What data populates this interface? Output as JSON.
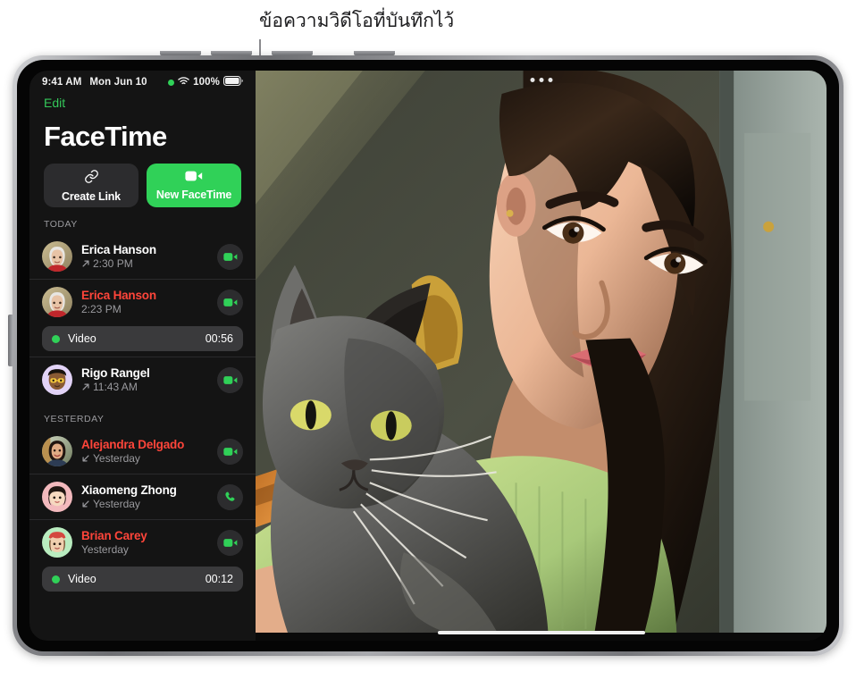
{
  "callout": {
    "text": "ข้อความวิดีโอที่บันทึกไว้"
  },
  "status_bar": {
    "time": "9:41 AM",
    "date": "Mon Jun 10",
    "battery_percent": "100%",
    "privacy_indicator": "green-camera-dot",
    "wifi_icon": "wifi-icon",
    "battery_icon": "battery-icon"
  },
  "sidebar": {
    "edit_label": "Edit",
    "app_title": "FaceTime",
    "create_link_label": "Create Link",
    "create_link_icon": "link-icon",
    "new_facetime_label": "New FaceTime",
    "new_facetime_icon": "video-camera-icon",
    "sections": [
      {
        "header": "TODAY",
        "rows": [
          {
            "name": "Erica Hanson",
            "missed": false,
            "direction": "outgoing",
            "time": "2:30 PM",
            "action_icon": "video-camera-icon",
            "avatar": "photo-erica",
            "attachment": null
          },
          {
            "name": "Erica Hanson",
            "missed": true,
            "direction": "none",
            "time": "2:23 PM",
            "action_icon": "video-camera-icon",
            "avatar": "photo-erica",
            "attachment": {
              "type": "Video",
              "duration": "00:56"
            }
          },
          {
            "name": "Rigo Rangel",
            "missed": false,
            "direction": "outgoing",
            "time": "11:43 AM",
            "action_icon": "video-camera-icon",
            "avatar": "memoji-rigo",
            "attachment": null
          }
        ]
      },
      {
        "header": "YESTERDAY",
        "rows": [
          {
            "name": "Alejandra Delgado",
            "missed": true,
            "direction": "incoming",
            "time": "Yesterday",
            "action_icon": "video-camera-icon",
            "avatar": "photo-alejandra",
            "attachment": null
          },
          {
            "name": "Xiaomeng Zhong",
            "missed": false,
            "direction": "incoming",
            "time": "Yesterday",
            "action_icon": "phone-icon",
            "avatar": "memoji-xiaomeng",
            "attachment": null
          },
          {
            "name": "Brian Carey",
            "missed": true,
            "direction": "none",
            "time": "Yesterday",
            "action_icon": "video-camera-icon",
            "avatar": "memoji-brian",
            "attachment": {
              "type": "Video",
              "duration": "00:12"
            }
          }
        ]
      }
    ]
  },
  "main_pane": {
    "menu_icon": "more-options-dots-icon",
    "home_indicator": "home-indicator",
    "photo_description": "woman holding a gray cat in sunlight"
  },
  "colors": {
    "accent_green": "#30d158",
    "missed_red": "#ff453a",
    "sidebar_bg": "#141414",
    "pill_bg": "#3a3a3c"
  }
}
